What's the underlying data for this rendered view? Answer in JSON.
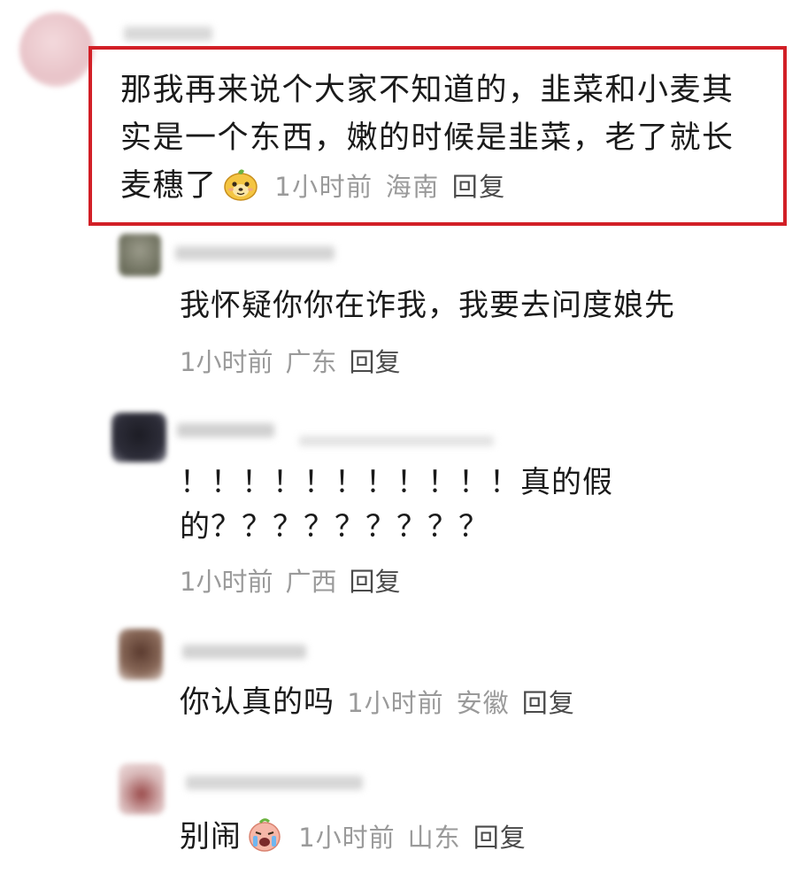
{
  "main_comment": {
    "lines": [
      "那我再来说个大家不知道的，韭菜和小麦其",
      "实是一个东西，嫩的时候是韭菜，老了就长",
      "麦穗了"
    ],
    "emoji": "smiling-dog-emoji-icon",
    "time": "1小时前",
    "location": "海南",
    "reply_label": "回复"
  },
  "replies": [
    {
      "lines": [
        "我怀疑你你在诈我，我要去问度娘先"
      ],
      "time": "1小时前",
      "location": "广东",
      "reply_label": "回复"
    },
    {
      "lines": [
        "！！！！！！！！！！！真的假",
        "的？？？？？？？？？"
      ],
      "time": "1小时前",
      "location": "广西",
      "reply_label": "回复"
    },
    {
      "lines": [
        "你认真的吗"
      ],
      "time": "1小时前",
      "location": "安徽",
      "reply_label": "回复"
    },
    {
      "lines": [
        "别闹"
      ],
      "emoji": "crying-emoji-icon",
      "time": "1小时前",
      "location": "山东",
      "reply_label": "回复"
    }
  ],
  "colors": {
    "highlight_border": "#d21f26",
    "meta_text": "#9a9a9a",
    "body_text": "#1a1a1a"
  }
}
